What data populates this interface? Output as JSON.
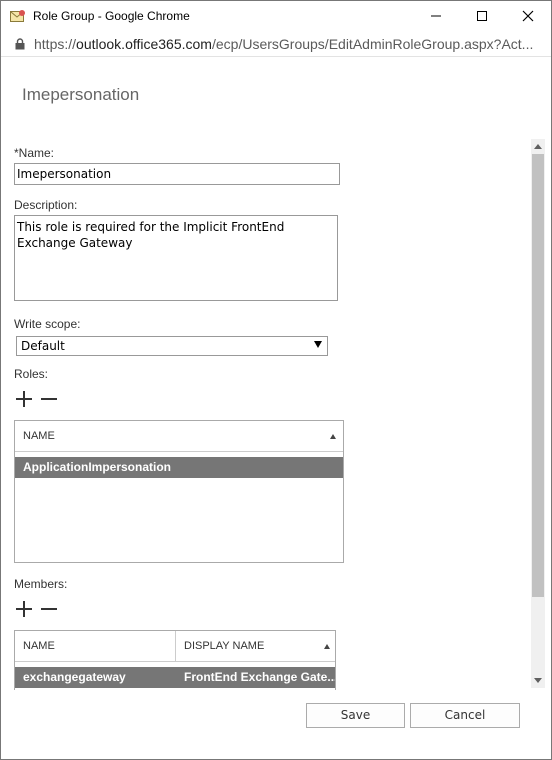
{
  "window": {
    "title": "Role Group - Google Chrome",
    "url_scheme": "https://",
    "url_host": "outlook.office365.com",
    "url_path": "/ecp/UsersGroups/EditAdminRoleGroup.aspx?Act..."
  },
  "page": {
    "title": "Imepersonation"
  },
  "form": {
    "name_label": "*Name:",
    "name_value": "Imepersonation",
    "description_label": "Description:",
    "description_value": "This role is required for the Implicit FrontEnd Exchange Gateway",
    "write_scope_label": "Write scope:",
    "write_scope_value": "Default",
    "roles_label": "Roles:",
    "members_label": "Members:"
  },
  "roles_grid": {
    "columns": [
      "NAME"
    ],
    "rows": [
      {
        "name": "ApplicationImpersonation"
      }
    ]
  },
  "members_grid": {
    "columns": [
      "NAME",
      "DISPLAY NAME"
    ],
    "rows": [
      {
        "name": "exchangegateway",
        "display_name": "FrontEnd Exchange Gate..."
      }
    ]
  },
  "footer": {
    "save_label": "Save",
    "cancel_label": "Cancel"
  },
  "colors": {
    "selected_row": "#767676",
    "scroll_thumb": "#c1c1c1"
  }
}
